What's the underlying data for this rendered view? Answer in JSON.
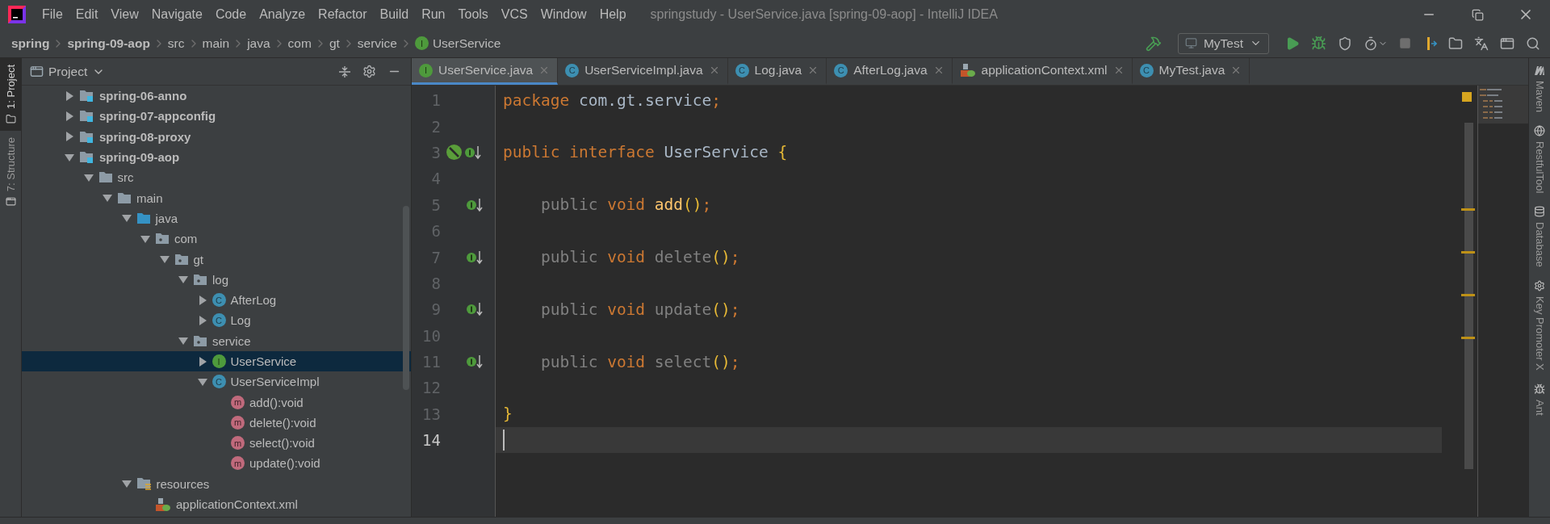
{
  "window": {
    "title": "springstudy - UserService.java [spring-09-aop] - IntelliJ IDEA",
    "menu": [
      "File",
      "Edit",
      "View",
      "Navigate",
      "Code",
      "Analyze",
      "Refactor",
      "Build",
      "Run",
      "Tools",
      "VCS",
      "Window",
      "Help"
    ]
  },
  "breadcrumbs": [
    {
      "label": "spring",
      "kind": "module"
    },
    {
      "label": "spring-09-aop",
      "kind": "module"
    },
    {
      "label": "src",
      "kind": "folder"
    },
    {
      "label": "main",
      "kind": "folder"
    },
    {
      "label": "java",
      "kind": "folder"
    },
    {
      "label": "com",
      "kind": "folder"
    },
    {
      "label": "gt",
      "kind": "folder"
    },
    {
      "label": "service",
      "kind": "folder"
    },
    {
      "label": "UserService",
      "kind": "interface",
      "icon_text": "I"
    }
  ],
  "toolbar": {
    "run_config": "MyTest"
  },
  "left_stripe": [
    {
      "label": "1: Project",
      "selected": true
    },
    {
      "label": "7: Structure",
      "selected": false
    }
  ],
  "project_panel": {
    "title": "Project",
    "tree": [
      {
        "label": "spring-06-anno",
        "kind": "module",
        "expanded": false,
        "selected": false
      },
      {
        "label": "spring-07-appconfig",
        "kind": "module",
        "expanded": false,
        "selected": false
      },
      {
        "label": "spring-08-proxy",
        "kind": "module",
        "expanded": false,
        "selected": false
      },
      {
        "label": "spring-09-aop",
        "kind": "module",
        "expanded": true,
        "selected": false,
        "children": [
          {
            "label": "src",
            "kind": "folder",
            "expanded": true,
            "selected": false,
            "children": [
              {
                "label": "main",
                "kind": "folder",
                "expanded": true,
                "selected": false,
                "children": [
                  {
                    "label": "java",
                    "kind": "source",
                    "expanded": true,
                    "selected": false,
                    "children": [
                      {
                        "label": "com",
                        "kind": "package",
                        "expanded": true,
                        "selected": false,
                        "children": [
                          {
                            "label": "gt",
                            "kind": "package",
                            "expanded": true,
                            "selected": false,
                            "children": [
                              {
                                "label": "log",
                                "kind": "package",
                                "expanded": true,
                                "selected": false,
                                "children": [
                                  {
                                    "label": "AfterLog",
                                    "kind": "class",
                                    "icon_text": "C",
                                    "expanded": false,
                                    "selected": false
                                  },
                                  {
                                    "label": "Log",
                                    "kind": "class",
                                    "icon_text": "C",
                                    "expanded": false,
                                    "selected": false
                                  }
                                ]
                              },
                              {
                                "label": "service",
                                "kind": "package",
                                "expanded": true,
                                "selected": false,
                                "children": [
                                  {
                                    "label": "UserService",
                                    "kind": "interface",
                                    "icon_text": "I",
                                    "expanded": false,
                                    "selected": true
                                  },
                                  {
                                    "label": "UserServiceImpl",
                                    "kind": "class",
                                    "icon_text": "C",
                                    "expanded": true,
                                    "selected": false,
                                    "children": [
                                      {
                                        "label": "add():void",
                                        "kind": "method",
                                        "icon_text": "m",
                                        "selected": false
                                      },
                                      {
                                        "label": "delete():void",
                                        "kind": "method",
                                        "icon_text": "m",
                                        "selected": false
                                      },
                                      {
                                        "label": "select():void",
                                        "kind": "method",
                                        "icon_text": "m",
                                        "selected": false
                                      },
                                      {
                                        "label": "update():void",
                                        "kind": "method",
                                        "icon_text": "m",
                                        "selected": false
                                      }
                                    ]
                                  }
                                ]
                              }
                            ]
                          }
                        ]
                      }
                    ]
                  },
                  {
                    "label": "resources",
                    "kind": "resources",
                    "expanded": true,
                    "selected": false,
                    "children": [
                      {
                        "label": "applicationContext.xml",
                        "kind": "xml",
                        "selected": false
                      }
                    ]
                  }
                ]
              }
            ]
          }
        ]
      }
    ]
  },
  "editor": {
    "tabs": [
      {
        "label": "UserService.java",
        "kind": "interface",
        "icon_text": "I",
        "selected": true
      },
      {
        "label": "UserServiceImpl.java",
        "kind": "class",
        "icon_text": "C",
        "selected": false
      },
      {
        "label": "Log.java",
        "kind": "class",
        "icon_text": "C",
        "selected": false
      },
      {
        "label": "AfterLog.java",
        "kind": "class",
        "icon_text": "C",
        "selected": false
      },
      {
        "label": "applicationContext.xml",
        "kind": "xml",
        "selected": false
      },
      {
        "label": "MyTest.java",
        "kind": "test",
        "icon_text": "C",
        "selected": false
      }
    ],
    "lines": [
      {
        "number": "1",
        "current": false,
        "kind": "plain",
        "tokens": [
          {
            "text": "package ",
            "kind": "keyword"
          },
          {
            "text": "com.gt.service",
            "kind": "plain"
          },
          {
            "text": ";",
            "kind": "keyword"
          }
        ]
      },
      {
        "number": "2",
        "current": false,
        "kind": "plain"
      },
      {
        "number": "3",
        "current": false,
        "kind": "bean-implemented",
        "tokens": [
          {
            "text": "public interface ",
            "kind": "keyword"
          },
          {
            "text": "UserService ",
            "kind": "plain"
          },
          {
            "text": "{",
            "kind": "brace"
          }
        ]
      },
      {
        "number": "4",
        "current": false,
        "kind": "plain"
      },
      {
        "number": "5",
        "current": false,
        "kind": "implemented",
        "tokens": [
          {
            "text": "    public ",
            "kind": "dim"
          },
          {
            "text": "void ",
            "kind": "keyword"
          },
          {
            "text": "add",
            "kind": "method"
          },
          {
            "text": "()",
            "kind": "brace"
          },
          {
            "text": ";",
            "kind": "keyword"
          }
        ]
      },
      {
        "number": "6",
        "current": false,
        "kind": "plain"
      },
      {
        "number": "7",
        "current": false,
        "kind": "implemented",
        "tokens": [
          {
            "text": "    public ",
            "kind": "dim"
          },
          {
            "text": "void ",
            "kind": "keyword"
          },
          {
            "text": "delete",
            "kind": "dim"
          },
          {
            "text": "()",
            "kind": "brace"
          },
          {
            "text": ";",
            "kind": "keyword"
          }
        ]
      },
      {
        "number": "8",
        "current": false,
        "kind": "plain"
      },
      {
        "number": "9",
        "current": false,
        "kind": "implemented",
        "tokens": [
          {
            "text": "    public ",
            "kind": "dim"
          },
          {
            "text": "void ",
            "kind": "keyword"
          },
          {
            "text": "update",
            "kind": "dim"
          },
          {
            "text": "()",
            "kind": "brace"
          },
          {
            "text": ";",
            "kind": "keyword"
          }
        ]
      },
      {
        "number": "10",
        "current": false,
        "kind": "plain"
      },
      {
        "number": "11",
        "current": false,
        "kind": "implemented",
        "tokens": [
          {
            "text": "    public ",
            "kind": "dim"
          },
          {
            "text": "void ",
            "kind": "keyword"
          },
          {
            "text": "select",
            "kind": "dim"
          },
          {
            "text": "()",
            "kind": "brace"
          },
          {
            "text": ";",
            "kind": "keyword"
          }
        ]
      },
      {
        "number": "12",
        "current": false,
        "kind": "plain"
      },
      {
        "number": "13",
        "current": false,
        "kind": "plain",
        "tokens": [
          {
            "text": "}",
            "kind": "brace"
          }
        ]
      },
      {
        "number": "14",
        "current": true,
        "kind": "plain"
      }
    ]
  },
  "right_stripe": [
    "Maven",
    "RestfulTool",
    "Database",
    "Key Promoter X",
    "Ant"
  ]
}
